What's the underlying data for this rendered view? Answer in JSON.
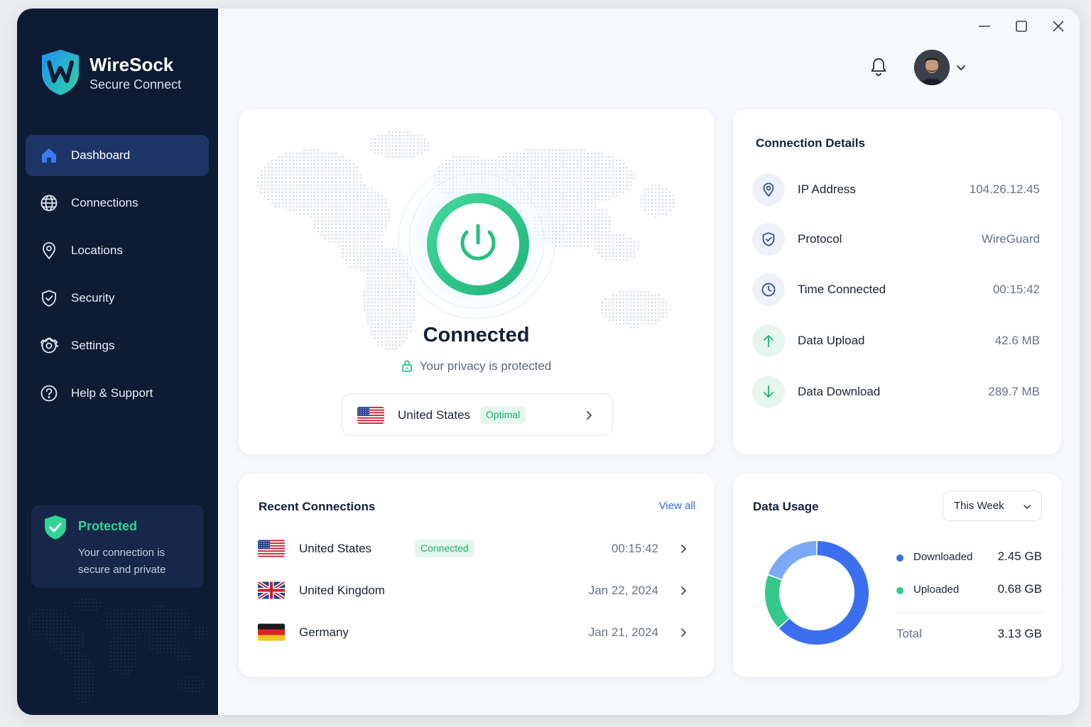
{
  "app": {
    "name": "WireSock",
    "subtitle": "Secure Connect"
  },
  "sidebar": {
    "items": [
      {
        "label": "Dashboard",
        "icon": "home-icon",
        "active": true
      },
      {
        "label": "Connections",
        "icon": "globe-icon"
      },
      {
        "label": "Locations",
        "icon": "location-pin-icon"
      },
      {
        "label": "Security",
        "icon": "shield-check-icon"
      },
      {
        "label": "Settings",
        "icon": "gear-icon"
      },
      {
        "label": "Help & Support",
        "icon": "help-circle-icon"
      }
    ],
    "status": {
      "title": "Protected",
      "text": "Your connection is secure and private"
    }
  },
  "status": {
    "title": "Connected",
    "subtitle": "Your privacy is protected",
    "location": {
      "country": "United States",
      "badge": "Optimal"
    }
  },
  "details": {
    "title": "Connection Details",
    "rows": [
      {
        "label": "IP Address",
        "value": "104.26.12.45",
        "icon": "location-pin-icon"
      },
      {
        "label": "Protocol",
        "value": "WireGuard",
        "icon": "shield-check-icon"
      },
      {
        "label": "Time Connected",
        "value": "00:15:42",
        "icon": "clock-icon"
      },
      {
        "label": "Data Upload",
        "value": "42.6 MB",
        "icon": "arrow-up-icon"
      },
      {
        "label": "Data Download",
        "value": "289.7 MB",
        "icon": "arrow-down-icon"
      }
    ]
  },
  "recent": {
    "title": "Recent Connections",
    "view_all": "View all",
    "rows": [
      {
        "country": "United States",
        "badge": "Connected",
        "time": "00:15:42"
      },
      {
        "country": "United Kingdom",
        "time": "Jan 22, 2024"
      },
      {
        "country": "Germany",
        "time": "Jan 21, 2024"
      }
    ]
  },
  "usage": {
    "title": "Data Usage",
    "range": "This Week",
    "downloaded_label": "Downloaded",
    "downloaded_value": "2.45 GB",
    "uploaded_label": "Uploaded",
    "uploaded_value": "0.68 GB",
    "total_label": "Total",
    "total_value": "3.13 GB",
    "segments": [
      {
        "name": "Downloaded",
        "value": 2.45,
        "color": "#3b6ff0"
      },
      {
        "name": "Uploaded",
        "value": 0.68,
        "color": "#34c98a"
      },
      {
        "value": 0.75,
        "color": "#7aa9f5"
      }
    ]
  },
  "colors": {
    "sidebar": "#0d1b33",
    "accent_green": "#2fd494",
    "accent_blue": "#2d6be4",
    "nav_active": "#1d3566"
  }
}
